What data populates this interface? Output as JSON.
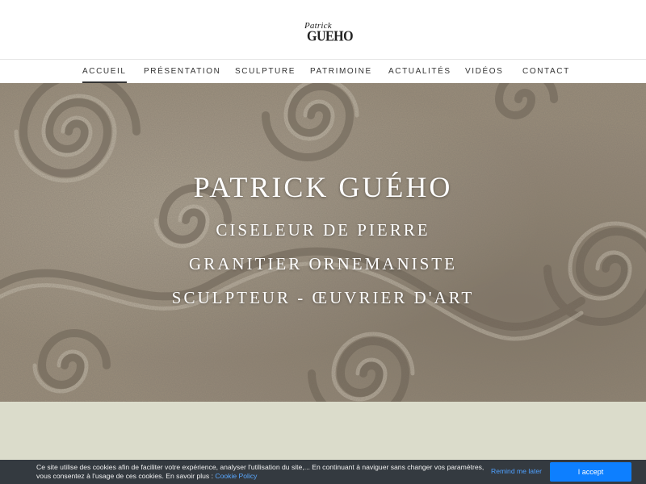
{
  "logo": {
    "first_name": "Patrick",
    "last_name": "GUEHO"
  },
  "nav": {
    "items": [
      {
        "label": "ACCUEIL",
        "active": true
      },
      {
        "label": "PRÉSENTATION",
        "active": false
      },
      {
        "label": "SCULPTURE",
        "active": false
      },
      {
        "label": "PATRIMOINE",
        "active": false
      },
      {
        "label": "ACTUALITÉS",
        "active": false
      },
      {
        "label": "VIDÉOS",
        "active": false
      },
      {
        "label": "CONTACT",
        "active": false
      }
    ]
  },
  "hero": {
    "title": "PATRICK GUÉHO",
    "line1": "CISELEUR DE PIERRE",
    "line2": "GRANITIER ORNEMANISTE",
    "line3": "SCULPTEUR - ŒUVRIER D'ART"
  },
  "cookie": {
    "message": "Ce site utilise des cookies afin de faciliter votre expérience, analyser l'utilisation du site,... En continuant à naviguer sans changer vos paramètres, vous consentez à l'usage de ces cookies. En savoir plus :",
    "policy_link": "Cookie Policy",
    "remind_label": "Remind me later",
    "accept_label": "I accept"
  },
  "colors": {
    "stone": "#a89a86",
    "band": "#dbdccb",
    "cookie_bg": "#343a40",
    "accent_blue": "#0d7fff"
  }
}
